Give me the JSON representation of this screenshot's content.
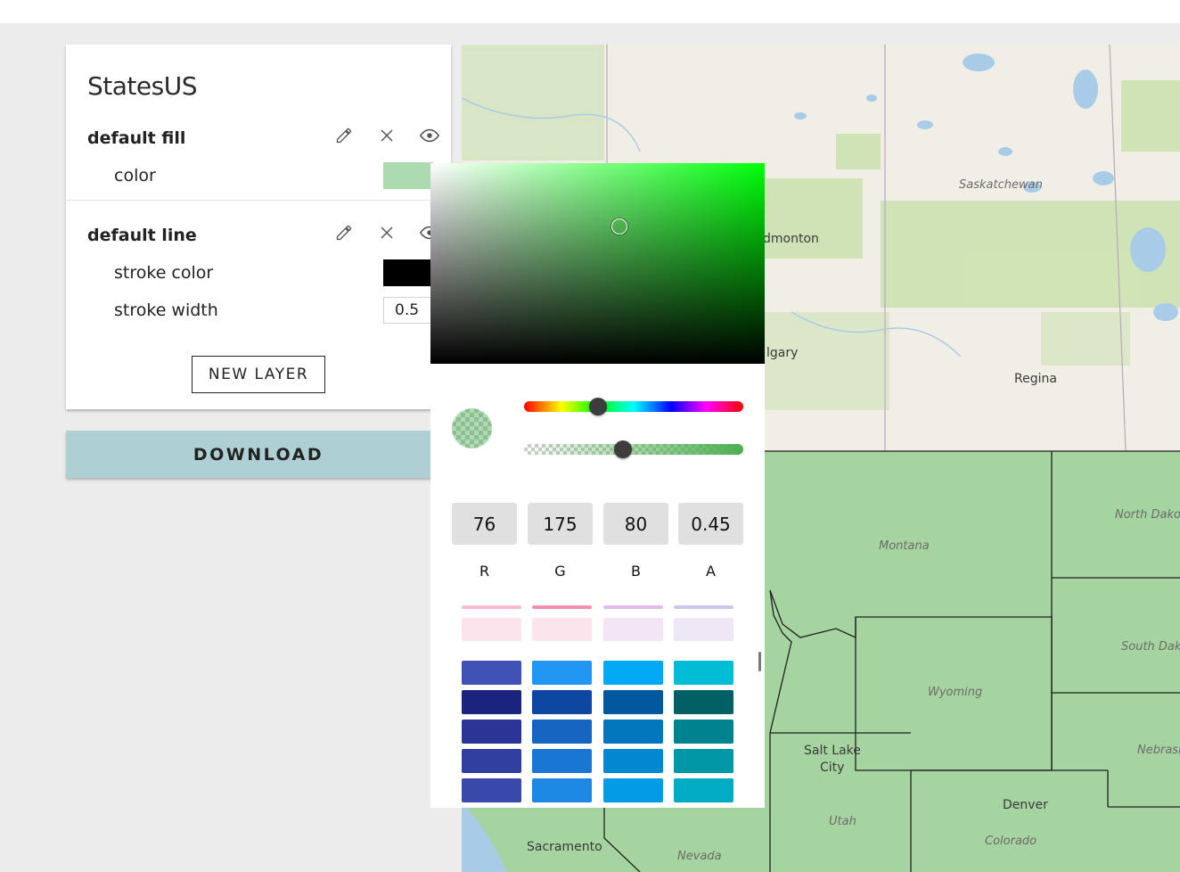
{
  "layers_panel": {
    "title": "StatesUS",
    "layers": [
      {
        "name": "default fill",
        "properties": [
          {
            "label": "color",
            "type": "swatch",
            "value_color": "#acdbb0"
          }
        ]
      },
      {
        "name": "default line",
        "properties": [
          {
            "label": "stroke color",
            "type": "swatch",
            "value_color": "#000000"
          },
          {
            "label": "stroke width",
            "type": "number",
            "value": "0.5"
          }
        ]
      }
    ],
    "icons": {
      "edit": "pencil-icon",
      "delete": "close-icon",
      "visibility": "eye-icon"
    },
    "new_layer_label": "NEW LAYER"
  },
  "download_label": "DOWNLOAD",
  "color_picker": {
    "hue_color": "#00ff0a",
    "hue_position": 0.34,
    "alpha_position": 0.45,
    "values": {
      "r": "76",
      "g": "175",
      "b": "80",
      "a": "0.45"
    },
    "labels": {
      "r": "R",
      "g": "G",
      "b": "B",
      "a": "A"
    },
    "preview_color": "rgba(76,175,80,0.45)",
    "palette_top_rows": [
      [
        "#f8bbd0",
        "#f48fb1",
        "#e1bee7",
        "#d1c4e9"
      ],
      [
        "#fde4ec",
        "#fce4ec",
        "#f3e5f5",
        "#ede7f6"
      ]
    ],
    "palette_rows": [
      [
        "#3f51b5",
        "#2196f3",
        "#03a9f4",
        "#00bcd4"
      ],
      [
        "#1a237e",
        "#0d47a1",
        "#01579b",
        "#006064"
      ],
      [
        "#283593",
        "#1565c0",
        "#0277bd",
        "#00838f"
      ],
      [
        "#303f9f",
        "#1976d2",
        "#0288d1",
        "#0097a7"
      ],
      [
        "#3949ab",
        "#1e88e5",
        "#039be5",
        "#00acc1"
      ]
    ]
  },
  "map": {
    "labels": [
      {
        "text": "Saskatchewan",
        "style": "italic"
      },
      {
        "text": "dmonton",
        "style": "city"
      },
      {
        "text": "lgary",
        "style": "city"
      },
      {
        "text": "Regina",
        "style": "city"
      },
      {
        "text": "North Dako",
        "style": "italic"
      },
      {
        "text": "Montana",
        "style": "italic"
      },
      {
        "text": "South Dako",
        "style": "italic"
      },
      {
        "text": "Wyoming",
        "style": "italic"
      },
      {
        "text": "Nebrask",
        "style": "italic"
      },
      {
        "text": "Salt Lake",
        "style": "city"
      },
      {
        "text": "City",
        "style": "city"
      },
      {
        "text": "Utah",
        "style": "italic"
      },
      {
        "text": "Denver",
        "style": "city"
      },
      {
        "text": "Colorado",
        "style": "italic"
      },
      {
        "text": "Sacramento",
        "style": "city"
      },
      {
        "text": "Nevada",
        "style": "italic"
      }
    ],
    "state_fill": "#a6d4a0",
    "land_color": "#f1eee6",
    "green_area_color": "#cfe3b6",
    "water_color": "#a8cce8"
  }
}
